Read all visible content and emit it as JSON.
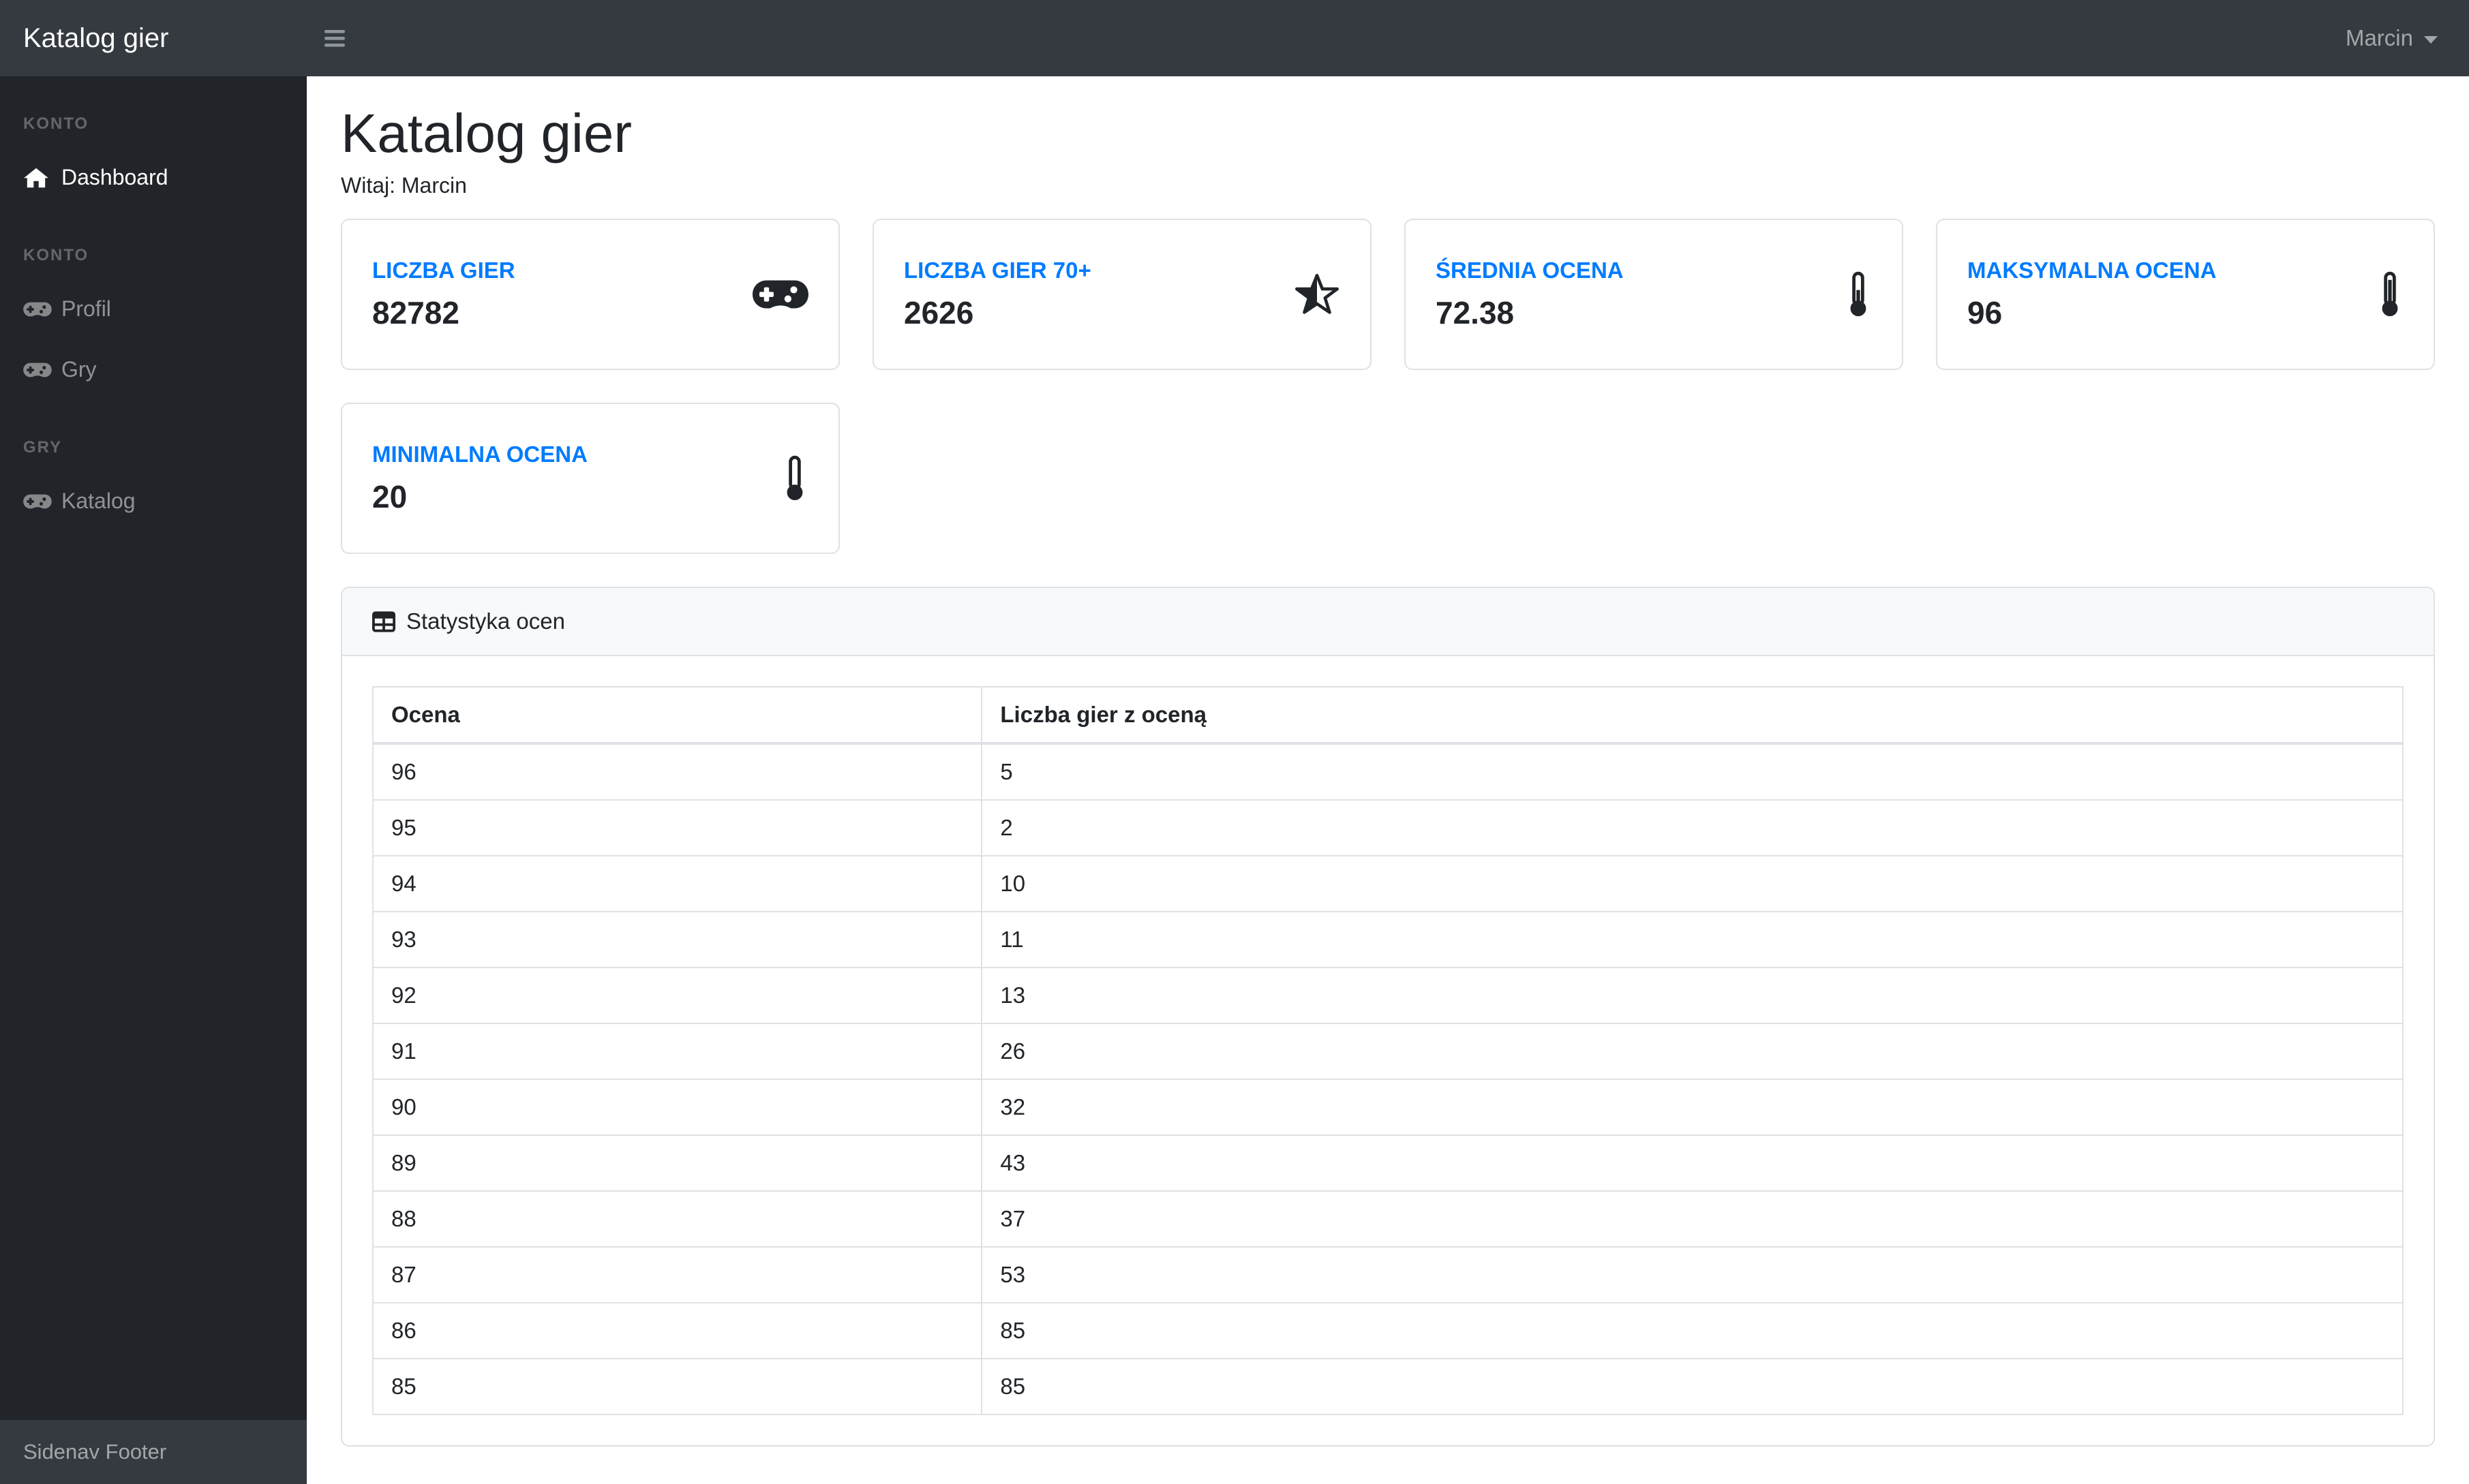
{
  "topnav": {
    "brand": "Katalog gier",
    "user": "Marcin"
  },
  "sidebar": {
    "sections": [
      {
        "heading": "KONTO",
        "items": [
          {
            "label": "Dashboard",
            "icon": "home-icon",
            "active": true
          }
        ]
      },
      {
        "heading": "KONTO",
        "items": [
          {
            "label": "Profil",
            "icon": "gamepad-icon",
            "active": false
          },
          {
            "label": "Gry",
            "icon": "gamepad-icon",
            "active": false
          }
        ]
      },
      {
        "heading": "GRY",
        "items": [
          {
            "label": "Katalog",
            "icon": "gamepad-icon",
            "active": false
          }
        ]
      }
    ],
    "footer": "Sidenav Footer"
  },
  "main": {
    "title": "Katalog gier",
    "welcome": "Witaj: Marcin",
    "stat_cards": [
      {
        "label": "LICZBA GIER",
        "value": "82782",
        "icon": "gamepad-icon"
      },
      {
        "label": "LICZBA GIER 70+",
        "value": "2626",
        "icon": "star-half-icon"
      },
      {
        "label": "ŚREDNIA OCENA",
        "value": "72.38",
        "icon": "thermometer-half-icon"
      },
      {
        "label": "MAKSYMALNA OCENA",
        "value": "96",
        "icon": "thermometer-full-icon"
      },
      {
        "label": "MINIMALNA OCENA",
        "value": "20",
        "icon": "thermometer-empty-icon"
      }
    ],
    "table_card": {
      "title": "Statystyka ocen",
      "icon": "table-icon",
      "columns": [
        "Ocena",
        "Liczba gier z oceną"
      ],
      "rows": [
        [
          96,
          5
        ],
        [
          95,
          2
        ],
        [
          94,
          10
        ],
        [
          93,
          11
        ],
        [
          92,
          13
        ],
        [
          91,
          26
        ],
        [
          90,
          32
        ],
        [
          89,
          43
        ],
        [
          88,
          37
        ],
        [
          87,
          53
        ],
        [
          86,
          85
        ],
        [
          85,
          85
        ]
      ]
    }
  },
  "colors": {
    "accent": "#007bff",
    "topnav_bg": "#343a40",
    "sidenav_bg": "#212529",
    "sidenav_footer_bg": "#343a40",
    "border": "#dee2e6",
    "card_header_bg": "#f8f9fa",
    "text": "#212529"
  }
}
